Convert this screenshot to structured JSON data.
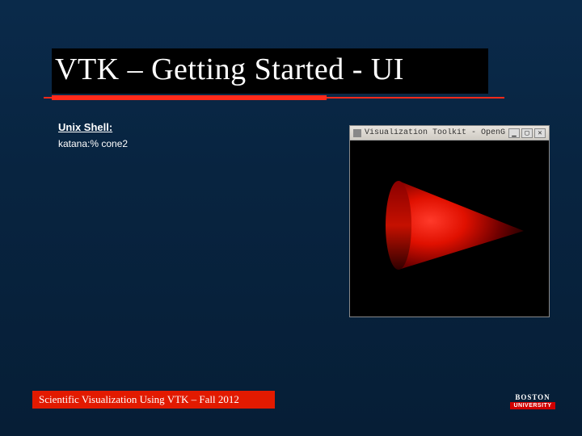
{
  "title": "VTK – Getting Started - UI",
  "body": {
    "shell_label": "Unix Shell:",
    "shell_command": "katana:% cone2"
  },
  "vtk_window": {
    "title": "Visualization Toolkit - OpenG",
    "controls": {
      "min": "▁",
      "max": "▢",
      "close": "✕"
    },
    "cone_color_light": "#ff1e1e",
    "cone_color_dark": "#3d0000"
  },
  "footer": "Scientific Visualization Using VTK – Fall 2012",
  "logo": {
    "top": "BOSTON",
    "bottom": "UNIVERSITY"
  }
}
